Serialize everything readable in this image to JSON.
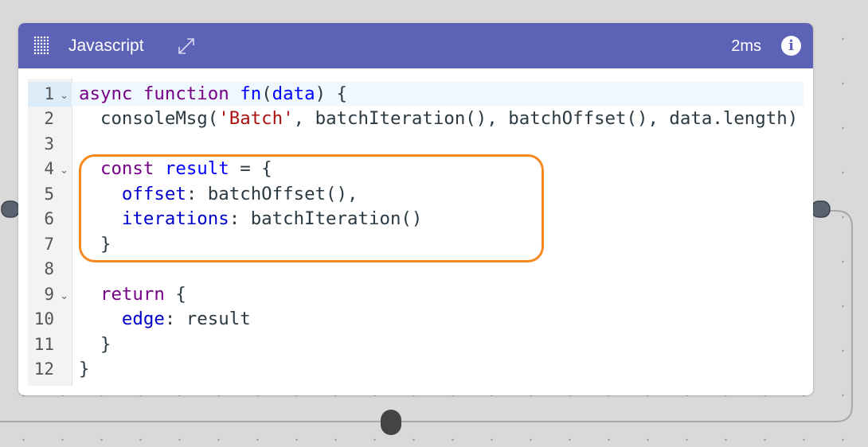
{
  "node": {
    "title": "Javascript",
    "timing": "2ms",
    "info_label": "i",
    "header_color": "#5c62b5",
    "icons": [
      "grip-icon",
      "expand-icon",
      "info-icon"
    ]
  },
  "editor": {
    "active_line": 1,
    "lines": [
      {
        "n": "1",
        "fold": true,
        "tokens": [
          [
            "kw",
            "async"
          ],
          [
            "",
            ""
          ],
          [
            "",
            " "
          ],
          [
            "kw",
            "function"
          ],
          [
            "",
            " "
          ],
          [
            "def",
            "fn"
          ],
          [
            "",
            "("
          ],
          [
            "def",
            "data"
          ],
          [
            "",
            ") {"
          ]
        ]
      },
      {
        "n": "2",
        "fold": false,
        "tokens": [
          [
            "",
            "  consoleMsg("
          ],
          [
            "str",
            "'Batch'"
          ],
          [
            "",
            ", batchIteration(), batchOffset(), data.length)"
          ]
        ]
      },
      {
        "n": "3",
        "fold": false,
        "tokens": []
      },
      {
        "n": "4",
        "fold": true,
        "tokens": [
          [
            "",
            "  "
          ],
          [
            "kw",
            "const"
          ],
          [
            "",
            " "
          ],
          [
            "def",
            "result"
          ],
          [
            "",
            " = {"
          ]
        ]
      },
      {
        "n": "5",
        "fold": false,
        "tokens": [
          [
            "",
            "    "
          ],
          [
            "prop",
            "offset"
          ],
          [
            "",
            ": batchOffset(),"
          ]
        ]
      },
      {
        "n": "6",
        "fold": false,
        "tokens": [
          [
            "",
            "    "
          ],
          [
            "prop",
            "iterations"
          ],
          [
            "",
            ": batchIteration()"
          ]
        ]
      },
      {
        "n": "7",
        "fold": false,
        "tokens": [
          [
            "",
            "  }"
          ]
        ]
      },
      {
        "n": "8",
        "fold": false,
        "tokens": []
      },
      {
        "n": "9",
        "fold": true,
        "tokens": [
          [
            "",
            "  "
          ],
          [
            "kw",
            "return"
          ],
          [
            "",
            " {"
          ]
        ]
      },
      {
        "n": "10",
        "fold": false,
        "tokens": [
          [
            "",
            "    "
          ],
          [
            "prop",
            "edge"
          ],
          [
            "",
            ": result"
          ]
        ]
      },
      {
        "n": "11",
        "fold": false,
        "tokens": [
          [
            "",
            "  }"
          ]
        ]
      },
      {
        "n": "12",
        "fold": false,
        "tokens": [
          [
            "",
            "}"
          ]
        ]
      }
    ],
    "highlight_lines": [
      4,
      7
    ],
    "highlight_color": "#f7891f"
  }
}
